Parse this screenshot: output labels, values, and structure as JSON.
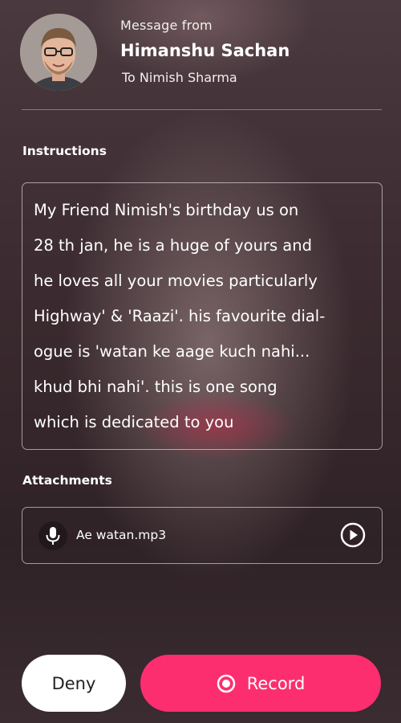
{
  "header": {
    "message_from_label": "Message from",
    "sender_name": "Himanshu Sachan",
    "recipient_line": "To Nimish Sharma"
  },
  "instructions": {
    "label": "Instructions",
    "text": "My Friend Nimish's birthday us on\n28 th jan, he is a huge of yours and\nhe loves all your movies particularly\nHighway' & 'Raazi'. his favourite dial-\nogue is 'watan ke aage kuch nahi...\nkhud bhi nahi'. this is one song\nwhich is dedicated to you"
  },
  "attachments": {
    "label": "Attachments",
    "items": [
      {
        "icon": "microphone-icon",
        "file_name": "Ae watan.mp3",
        "action_icon": "play-icon"
      }
    ]
  },
  "actions": {
    "deny_label": "Deny",
    "record_label": "Record",
    "record_icon": "record-icon"
  },
  "colors": {
    "accent": "#fc2e70",
    "deny_bg": "#ffffff"
  }
}
